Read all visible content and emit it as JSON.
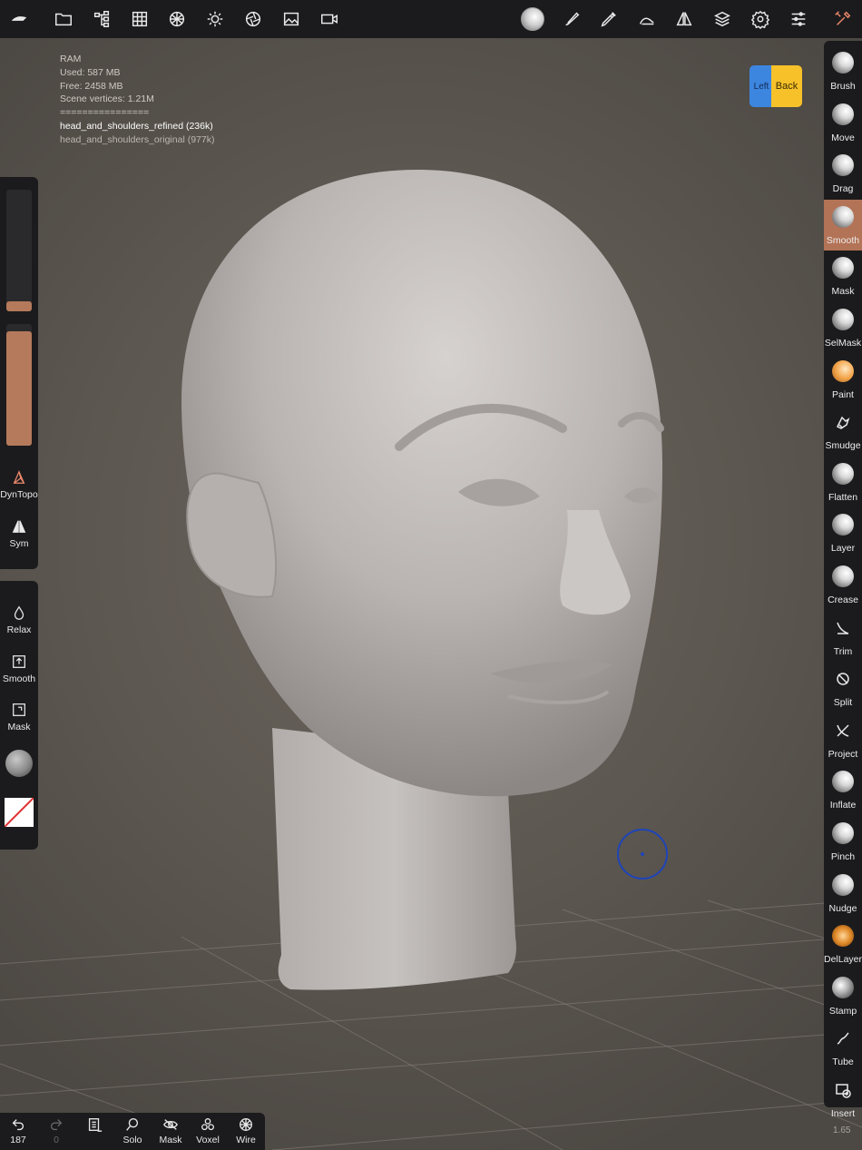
{
  "app": {
    "name": "Nomad Sculpt"
  },
  "topbar": {
    "icons": [
      "logo-icon",
      "folder-icon",
      "scene-tree-icon",
      "grid-icon",
      "material-sphere-icon",
      "light-icon",
      "postprocess-icon",
      "background-image-icon",
      "video-icon",
      "smooth-brush-icon",
      "paint-brush-icon",
      "picker-icon",
      "stroke-icon",
      "symmetry-icon",
      "layers-icon",
      "settings-icon",
      "sliders-icon",
      "tools-icon"
    ]
  },
  "stats": {
    "ram_label": "RAM",
    "used": "Used: 587 MB",
    "free": "Free: 2458 MB",
    "vertices": "Scene vertices: 1.21M",
    "separator": "================",
    "mesh_active": "head_and_shoulders_refined (236k)",
    "mesh_other": "head_and_shoulders_original (977k)"
  },
  "viewcube": {
    "left": "Left",
    "back": "Back"
  },
  "left_panel": {
    "radius_level": 0.08,
    "intensity_level": 0.94,
    "dyntopo": "DynTopo",
    "sym": "Sym"
  },
  "left_panel2": {
    "relax": "Relax",
    "smooth": "Smooth",
    "mask": "Mask"
  },
  "tools": [
    {
      "label": "Brush",
      "icon": "brush-ball-icon"
    },
    {
      "label": "Move",
      "icon": "move-ball-icon"
    },
    {
      "label": "Drag",
      "icon": "drag-ball-icon"
    },
    {
      "label": "Smooth",
      "icon": "smooth-ball-icon",
      "active": true
    },
    {
      "label": "Mask",
      "icon": "mask-ball-icon"
    },
    {
      "label": "SelMask",
      "icon": "selmask-ball-icon"
    },
    {
      "label": "Paint",
      "icon": "paint-ball-icon"
    },
    {
      "label": "Smudge",
      "icon": "smudge-icon"
    },
    {
      "label": "Flatten",
      "icon": "flatten-ball-icon"
    },
    {
      "label": "Layer",
      "icon": "layer-ball-icon"
    },
    {
      "label": "Crease",
      "icon": "crease-ball-icon"
    },
    {
      "label": "Trim",
      "icon": "trim-icon"
    },
    {
      "label": "Split",
      "icon": "split-icon"
    },
    {
      "label": "Project",
      "icon": "project-icon"
    },
    {
      "label": "Inflate",
      "icon": "inflate-ball-icon"
    },
    {
      "label": "Pinch",
      "icon": "pinch-ball-icon"
    },
    {
      "label": "Nudge",
      "icon": "nudge-ball-icon"
    },
    {
      "label": "DelLayer",
      "icon": "dellayer-ball-icon"
    },
    {
      "label": "Stamp",
      "icon": "stamp-ball-icon"
    },
    {
      "label": "Tube",
      "icon": "tube-icon"
    },
    {
      "label": "Insert",
      "icon": "insert-icon"
    }
  ],
  "bottombar": {
    "undo_count": "187",
    "redo_count": "0",
    "solo": "Solo",
    "mask": "Mask",
    "voxel": "Voxel",
    "wire": "Wire"
  },
  "version": "1.65",
  "colors": {
    "accent": "#b37356",
    "panel": "#1b1b1d",
    "cursor": "#1e44b8",
    "viewcube_left": "#3d86e0",
    "viewcube_back": "#f7c12a"
  }
}
